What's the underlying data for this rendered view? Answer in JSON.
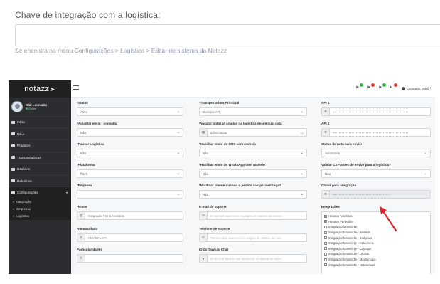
{
  "top": {
    "label": "Chave de integração com a logística:",
    "value": "",
    "hint": "Se encontra no menu Configurações > Logística > Editar do sistema da Notazz"
  },
  "sidebar": {
    "logo": "notazz",
    "user_name": "Olá, Leonardo",
    "user_status": "Online",
    "items": [
      {
        "label": "Início",
        "icon": "home-icon"
      },
      {
        "label": "NF-e",
        "icon": "document-icon"
      },
      {
        "label": "Produtos",
        "icon": "box-icon"
      },
      {
        "label": "Transportadoras",
        "icon": "truck-icon"
      },
      {
        "label": "Usuários",
        "icon": "user-icon"
      },
      {
        "label": "Relatórios",
        "icon": "chart-icon"
      },
      {
        "label": "Configurações",
        "icon": "wrench-icon"
      }
    ],
    "sub_items": [
      "Integração",
      "Empresas",
      "Logística"
    ]
  },
  "topbar": {
    "user_label": "Leonardo (943)",
    "notification_colors": [
      "#3dbb4f",
      "#e23b3b",
      "#3dbb4f",
      "#e23b3b"
    ]
  },
  "form": {
    "col1": {
      "status": {
        "label": "*Status",
        "value": "Ativo"
      },
      "atrasar": {
        "label": "*Adiantar envio / consulta",
        "value": "Não"
      },
      "pausar": {
        "label": "*Pausar Logística",
        "value": "Não"
      },
      "plataforma": {
        "label": "*Plataforma",
        "value": "Pierit"
      },
      "empresa": {
        "label": "*Empresa",
        "value": ""
      },
      "nome": {
        "label": "*Nome",
        "value": "Integração Pier & Amostras"
      },
      "almoxarifado": {
        "label": "Almoxarifado",
        "value": "ANVISA LAPA"
      },
      "particularidades": {
        "label": "Particularidades",
        "value": ""
      }
    },
    "col2": {
      "transportadora": {
        "label": "*Transportadora Principal",
        "value": "Correios-AR"
      },
      "vincular": {
        "label": "Vincular notas já criadas na logística desde qual data",
        "value": "dd/mm/aaaa"
      },
      "sms": {
        "label": "*Habilitar envio de SMS com rastreio",
        "value": "Não"
      },
      "whatsapp": {
        "label": "*Habilitar envio de WhatsApp com rastreio",
        "value": "Não"
      },
      "notificar": {
        "label": "*Notificar cliente quando o pedido sair para entrega?",
        "value": "Não"
      },
      "email": {
        "label": "E-mail de suporte",
        "placeholder": "E-mail que aparecerá na página de rastreio do rastreio"
      },
      "telefone": {
        "label": "Telefone de suporte",
        "placeholder": "Telefone que aparecerá na página de rastreio da nota"
      },
      "tawk": {
        "label": "ID do Tawk.to Chat",
        "placeholder": "ID do chat Tawk.to que aparecerá na página de rastre"
      }
    },
    "col3": {
      "api1": {
        "label": "API 1"
      },
      "api2": {
        "label": "API 2"
      },
      "status_nota": {
        "label": "Status da nota para envio:",
        "value": "Autorizada"
      },
      "validar_cep": {
        "label": "Validar CEP antes de enviar para a logística?",
        "value": "Não"
      },
      "chave": {
        "label": "Chave para integração"
      },
      "integracoes_label": "Integrações",
      "integracoes": [
        {
          "label": "Hmaroo Amostras",
          "checked": true
        },
        {
          "label": "Hmaroo Perfectlife",
          "checked": true
        },
        {
          "label": "Integração Monetizze",
          "checked": false
        },
        {
          "label": "Integração Monetizze - Biosbelt",
          "checked": false
        },
        {
          "label": "Integração Monetizze - Bodycaps",
          "checked": false
        },
        {
          "label": "Integração Monetizze - Celucreme",
          "checked": false
        },
        {
          "label": "Integração Monetizze - Daycaps",
          "checked": false
        },
        {
          "label": "Integração Monetizze - Lecitus",
          "checked": false
        },
        {
          "label": "Integração Monetizze - Maxbercaps",
          "checked": false
        },
        {
          "label": "Integração Monetizze - Naturecaps",
          "checked": false
        }
      ]
    }
  },
  "accent": "#d9262c"
}
